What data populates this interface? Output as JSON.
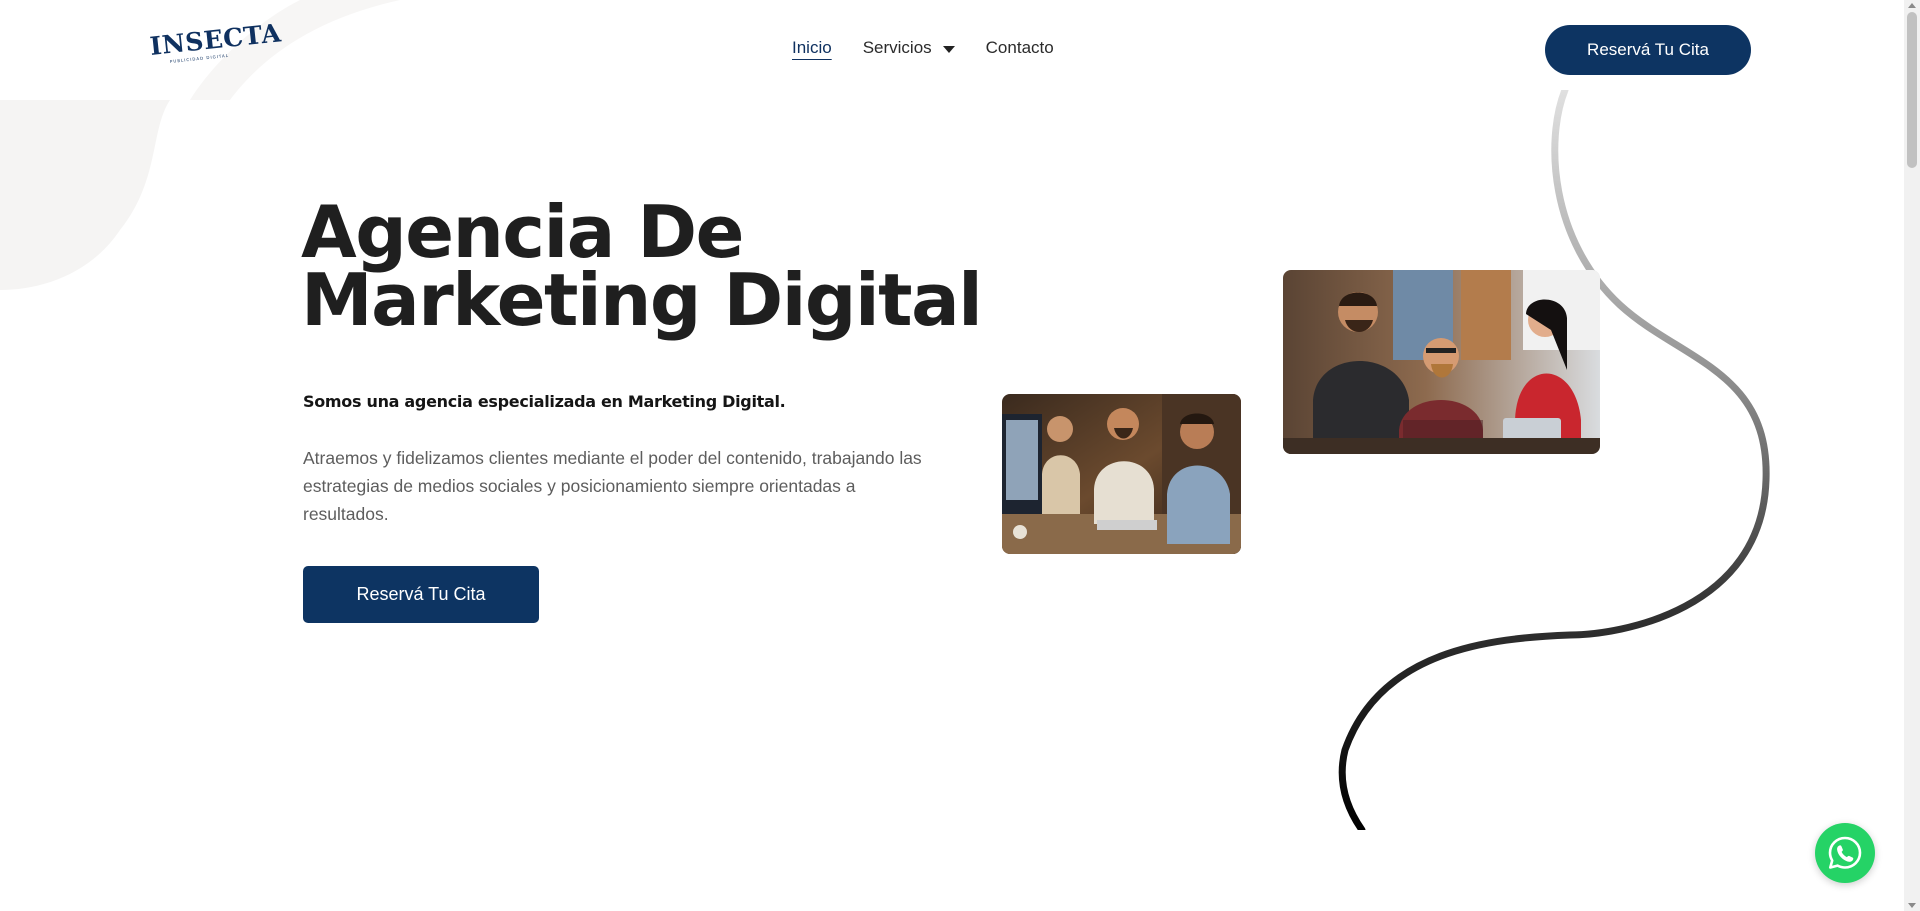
{
  "brand": {
    "name": "INSECTA",
    "tagline": "PUBLICIDAD DIGITAL",
    "primary_color": "#0d3462"
  },
  "nav": {
    "items": [
      {
        "label": "Inicio",
        "active": true
      },
      {
        "label": "Servicios",
        "active": false,
        "dropdown": true
      },
      {
        "label": "Contacto",
        "active": false
      }
    ],
    "cta_label": "Reservá Tu Cita"
  },
  "hero": {
    "title_line1": "Agencia De",
    "title_line2": "Marketing Digital",
    "tagline": "Somos una agencia especializada en Marketing Digital.",
    "description": "Atraemos y fidelizamos clientes mediante el poder del contenido, trabajando las estrategias de medios sociales y posicionamiento siempre orientadas a resultados.",
    "cta_label": "Reservá Tu Cita"
  },
  "images": {
    "team_at_computer": "photo of team working at a computer",
    "team_meeting": "photo of team meeting around a laptop"
  },
  "floating": {
    "icon": "whatsapp-icon",
    "color": "#25d366"
  }
}
